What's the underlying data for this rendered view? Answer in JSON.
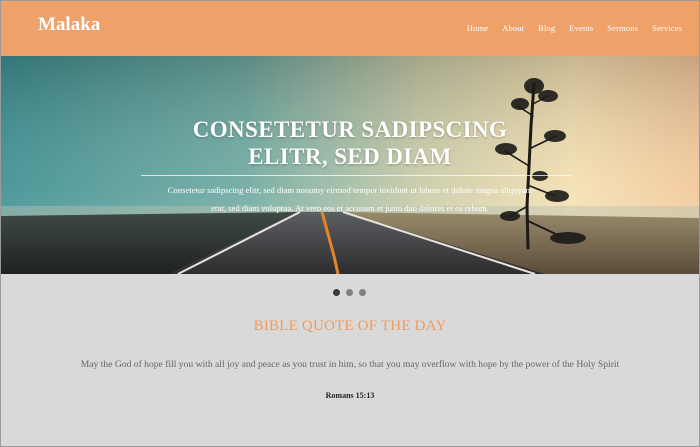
{
  "header": {
    "logo": "Malaka",
    "nav": [
      {
        "label": "Home"
      },
      {
        "label": "About"
      },
      {
        "label": "Blog"
      },
      {
        "label": "Events"
      },
      {
        "label": "Sermons"
      },
      {
        "label": "Services"
      }
    ]
  },
  "hero": {
    "title_line1": "CONSETETUR SADIPSCING",
    "title_line2": "ELITR, SED DIAM",
    "text_line1": "Consetetur sadipscing elitr, sed diam nonumy eirmod tempor invidunt ut labore et dolore magna aliquyam",
    "text_line2": "erat, sed diam voluptua. At vero eos et accusam et justo duo dolores et ea rebum."
  },
  "slider": {
    "dots": 3,
    "active_index": 0
  },
  "quote": {
    "heading": "BIBLE QUOTE OF THE DAY",
    "text": "May the God of hope fill you with all joy and peace as you trust in him, so that you may overflow with hope by the power of the Holy Spirit",
    "reference": "Romans 15:13"
  },
  "colors": {
    "header_bg": "#eea26a",
    "accent": "#ee9b5d",
    "body_bg": "#d9d9d9"
  }
}
